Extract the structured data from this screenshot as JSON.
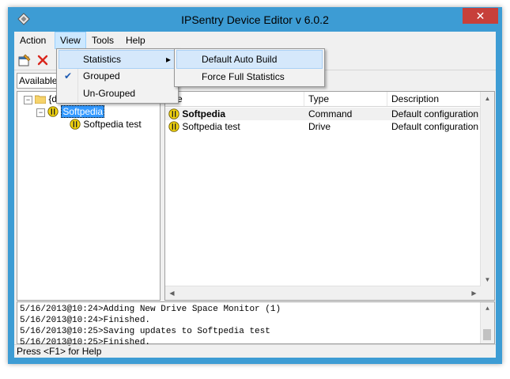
{
  "window": {
    "title": "IPSentry Device Editor v 6.0.2",
    "close_glyph": "✕"
  },
  "menubar": {
    "items": [
      "Action",
      "View",
      "Tools",
      "Help"
    ]
  },
  "view_menu": {
    "items": [
      {
        "label": "Statistics",
        "checked": false,
        "submenu": true
      },
      {
        "label": "Grouped",
        "checked": true,
        "submenu": false
      },
      {
        "label": "Un-Grouped",
        "checked": false,
        "submenu": false
      }
    ],
    "submenu_arrow": "▸",
    "check_glyph": "✔"
  },
  "statistics_submenu": {
    "items": [
      "Default Auto Build",
      "Force Full Statistics"
    ]
  },
  "available_label": "Available",
  "tree": {
    "root_label": "{d",
    "group_label": "Softpedia",
    "child_label": "Softpedia test",
    "expander_minus": "−"
  },
  "list": {
    "columns": [
      "me",
      "Type",
      "Description"
    ],
    "rows": [
      {
        "name": "Softpedia",
        "type": "Command",
        "description": "Default configuration temp",
        "bold": true
      },
      {
        "name": "Softpedia test",
        "type": "Drive",
        "description": "Default configuration temp",
        "bold": false
      }
    ]
  },
  "log": {
    "lines": [
      "5/16/2013@10:24>Adding New Drive Space Monitor (1)",
      "5/16/2013@10:24>Finished.",
      "5/16/2013@10:25>Saving updates to Softpedia test",
      "5/16/2013@10:25>Finished."
    ]
  },
  "status": {
    "text": "Press <F1> for Help"
  },
  "colors": {
    "frame": "#3d9cd4",
    "close": "#c7403a",
    "selection": "#3399ff",
    "warning": "#f2d40f"
  }
}
